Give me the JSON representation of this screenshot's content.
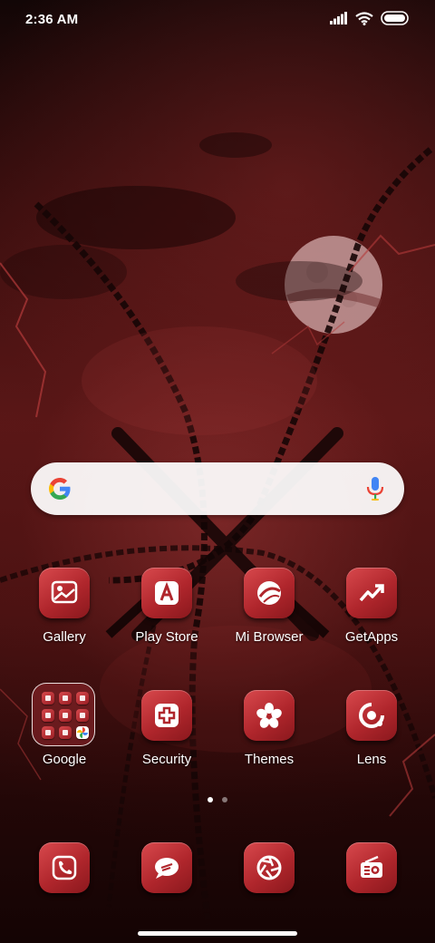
{
  "status_bar": {
    "time": "2:36 AM",
    "icons": [
      "signal-icon",
      "wifi-icon",
      "battery-icon"
    ]
  },
  "search_bar": {
    "icons": [
      "google-g-icon",
      "microphone-icon"
    ]
  },
  "apps": [
    {
      "label": "Gallery",
      "icon": "gallery-icon"
    },
    {
      "label": "Play Store",
      "icon": "play-store-icon"
    },
    {
      "label": "Mi Browser",
      "icon": "browser-icon"
    },
    {
      "label": "GetApps",
      "icon": "getapps-icon"
    },
    {
      "label": "Google",
      "icon": "folder-icon"
    },
    {
      "label": "Security",
      "icon": "security-icon"
    },
    {
      "label": "Themes",
      "icon": "themes-icon"
    },
    {
      "label": "Lens",
      "icon": "lens-icon"
    }
  ],
  "dock": [
    {
      "icon": "phone-icon"
    },
    {
      "icon": "messages-icon"
    },
    {
      "icon": "camera-icon"
    },
    {
      "icon": "radio-icon"
    }
  ],
  "page_indicator": {
    "count": 2,
    "active": 1
  },
  "colors": {
    "icon_red": "#c0333a",
    "wallpaper_dark": "#3a0e0e",
    "text": "#ffffff"
  }
}
